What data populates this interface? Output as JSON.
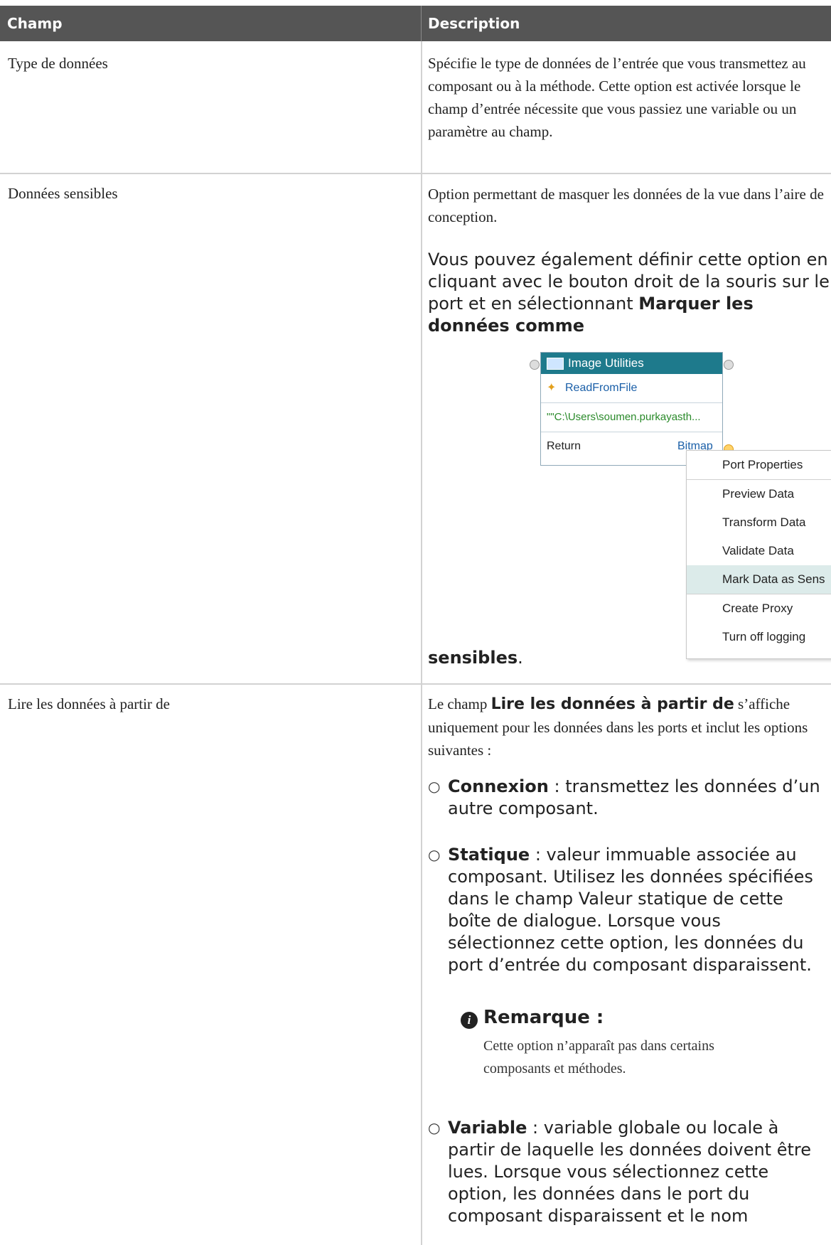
{
  "table": {
    "header": {
      "col1": "Champ",
      "col2": "Description"
    },
    "rows": [
      {
        "field": "Type de données",
        "description": "Spécifie le type de données de l’entrée que vous transmettez au composant ou à la méthode. Cette option est activée lorsque le champ d’entrée nécessite que vous passiez une variable ou un paramètre au champ."
      },
      {
        "field": "Données sensibles",
        "description": "Option permettant de masquer les données de la vue dans l’aire de conception.",
        "extra_text": "Vous pouvez également définir cette option en cliquant avec le bouton droit de la souris sur le port et en sélectionnant",
        "extra_bold": "Marquer les données comme",
        "extra_bold_end": "sensibles",
        "extra_end": "."
      },
      {
        "field": "Lire les données à partir de",
        "intro_pre": "Le champ",
        "intro_bold": "Lire les données à partir de",
        "intro_post": "s’affiche uniquement pour les données dans les ports et inclut les options suivantes :",
        "options": [
          {
            "bold": "Connexion",
            "text": " : transmettez les données d’un autre composant."
          },
          {
            "bold": "Statique",
            "text": " : valeur immuable associée au composant. Utilisez les données spécifiées dans le champ Valeur statique de cette boîte de dialogue. Lorsque vous sélectionnez cette option, les données du port d’entrée du composant disparaissent."
          },
          {
            "bold": "Variable",
            "text": " : variable globale ou locale à partir de laquelle les données doivent être lues. Lorsque vous sélectionnez cette option, les données dans le port du composant disparaissent et le nom"
          }
        ],
        "note_title": "Remarque :",
        "note_text": "Cette option n’apparaît pas dans certains composants et méthodes."
      }
    ]
  },
  "diagram": {
    "node_title": "Image Utilities",
    "method": "ReadFromFile",
    "param": "\"\"C:\\Users\\soumen.purkayasth...",
    "return_label": "Return",
    "return_type": "Bitmap",
    "menu_items": [
      "Port Properties",
      "Preview Data",
      "Transform Data",
      "Validate Data",
      "Mark Data as Sens",
      "Create Proxy",
      "Turn off logging"
    ],
    "colors": {
      "node_header": "#1e7a8c",
      "menu_selected": "#dcebea",
      "method_text": "#1a5fa8",
      "param_text": "#2a8a2a"
    }
  }
}
